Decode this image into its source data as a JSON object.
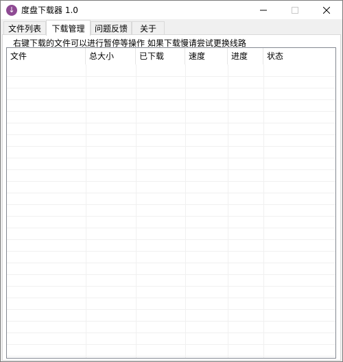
{
  "window": {
    "title": "度盘下载器 1.0",
    "icon": "download-arrow-icon"
  },
  "tabs": [
    {
      "label": "文件列表",
      "active": false
    },
    {
      "label": "下载管理",
      "active": true
    },
    {
      "label": "问题反馈",
      "active": false
    },
    {
      "label": "关于",
      "active": false
    }
  ],
  "hint": "右键下载的文件可以进行暂停等操作  如果下载慢请尝试更换线路",
  "listview": {
    "columns": [
      "文件",
      "总大小",
      "已下载",
      "速度",
      "进度",
      "状态"
    ],
    "rows": []
  }
}
